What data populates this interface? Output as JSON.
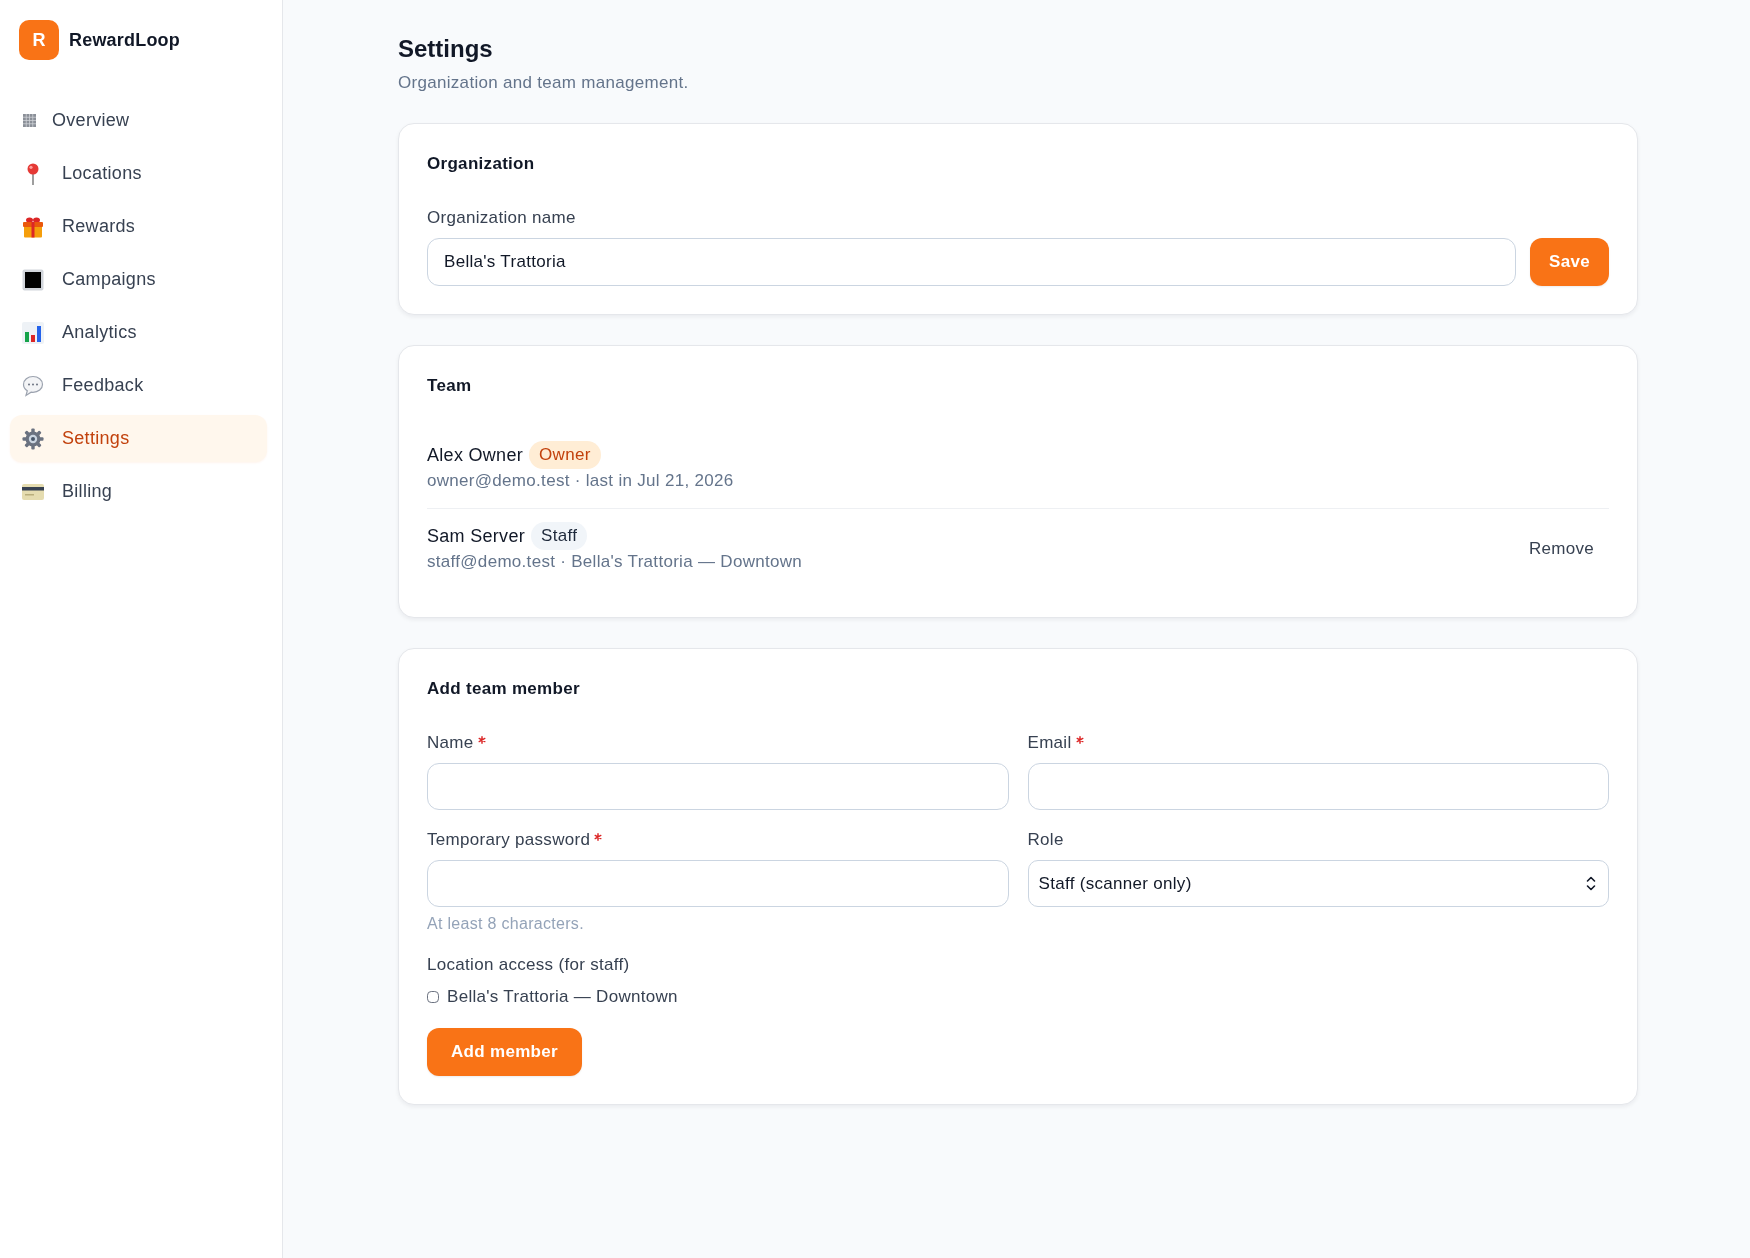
{
  "sidebar": {
    "brand": {
      "logo_letter": "R",
      "name": "RewardLoop"
    },
    "items": [
      {
        "label": "Overview",
        "selected": false
      },
      {
        "label": "Locations",
        "selected": false
      },
      {
        "label": "Rewards",
        "selected": false
      },
      {
        "label": "Campaigns",
        "selected": false
      },
      {
        "label": "Analytics",
        "selected": false
      },
      {
        "label": "Feedback",
        "selected": false
      },
      {
        "label": "Settings",
        "selected": true
      },
      {
        "label": "Billing",
        "selected": false
      }
    ]
  },
  "page": {
    "title": "Settings",
    "subtitle": "Organization and team management."
  },
  "organization": {
    "heading": "Organization",
    "field_label": "Organization name",
    "field_value": "Bella's Trattoria",
    "save_button": "Save"
  },
  "team": {
    "heading": "Team",
    "members": [
      {
        "name": "Alex Owner",
        "role": "Owner",
        "kind": "owner",
        "details": "owner@demo.test · last in Jul 21, 2026"
      },
      {
        "name": "Sam Server",
        "role": "Staff",
        "kind": "staff",
        "details": "staff@demo.test · Bella's Trattoria — Downtown",
        "action": "Remove"
      }
    ]
  },
  "add_member": {
    "heading": "Add team member",
    "fields": [
      {
        "kind": "input",
        "label": "Name",
        "required": true
      },
      {
        "kind": "input",
        "label": "Email",
        "required": true
      },
      {
        "kind": "input",
        "label": "Temporary password",
        "required": true,
        "hint": "At least 8 characters."
      },
      {
        "kind": "select",
        "label": "Role",
        "required": false,
        "value": "Staff (scanner only)"
      }
    ],
    "location_access": {
      "label": "Location access (for staff)",
      "options": [
        {
          "label": "Bella's Trattoria — Downtown",
          "checked": false
        }
      ]
    },
    "submit_button": "Add member"
  }
}
